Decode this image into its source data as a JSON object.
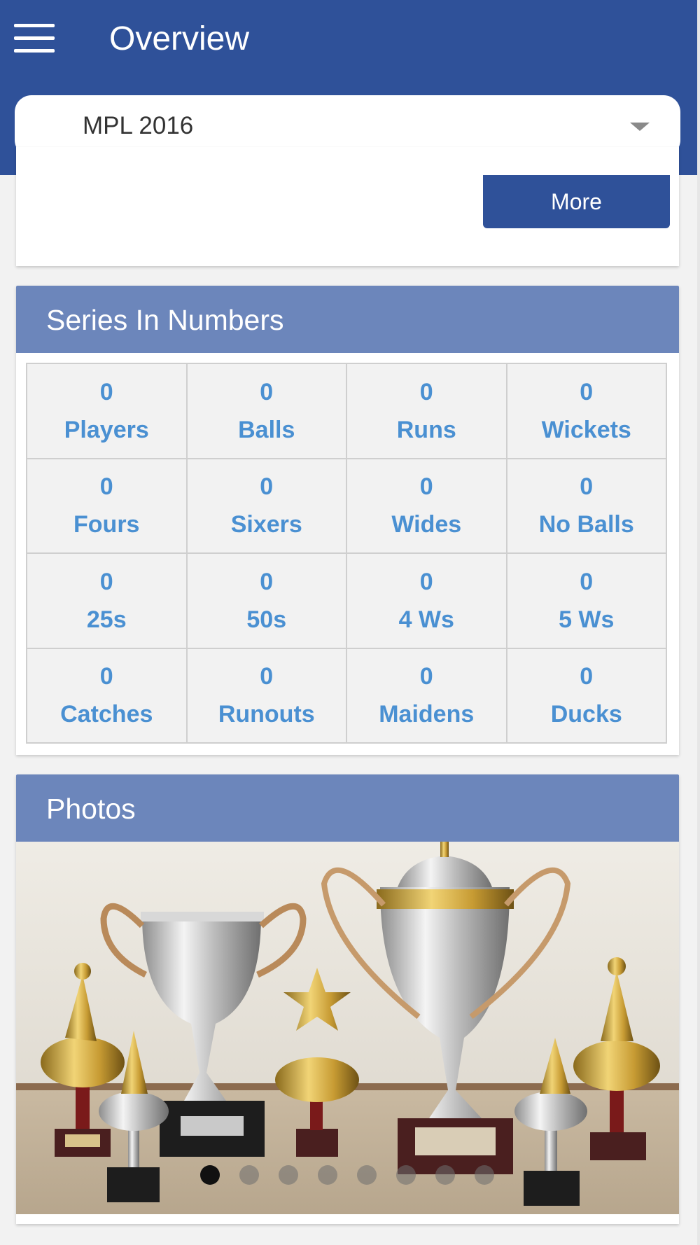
{
  "header": {
    "title": "Overview",
    "menu_icon": "hamburger-menu-icon",
    "background": "#2f5199"
  },
  "series_selector": {
    "selected": "MPL 2016",
    "icon": "caret-down-icon"
  },
  "summary_card": {
    "more_label": "More"
  },
  "series_in_numbers": {
    "title": "Series In Numbers",
    "stats": [
      {
        "value": "0",
        "label": "Players"
      },
      {
        "value": "0",
        "label": "Balls"
      },
      {
        "value": "0",
        "label": "Runs"
      },
      {
        "value": "0",
        "label": "Wickets"
      },
      {
        "value": "0",
        "label": "Fours"
      },
      {
        "value": "0",
        "label": "Sixers"
      },
      {
        "value": "0",
        "label": "Wides"
      },
      {
        "value": "0",
        "label": "No Balls"
      },
      {
        "value": "0",
        "label": "25s"
      },
      {
        "value": "0",
        "label": "50s"
      },
      {
        "value": "0",
        "label": "4 Ws"
      },
      {
        "value": "0",
        "label": "5 Ws"
      },
      {
        "value": "0",
        "label": "Catches"
      },
      {
        "value": "0",
        "label": "Runouts"
      },
      {
        "value": "0",
        "label": "Maidens"
      },
      {
        "value": "0",
        "label": "Ducks"
      }
    ],
    "text_color": "#4a90d2"
  },
  "photos": {
    "title": "Photos",
    "slide_count": 8,
    "active_slide": 1,
    "photo_subject": "trophy-photo"
  }
}
